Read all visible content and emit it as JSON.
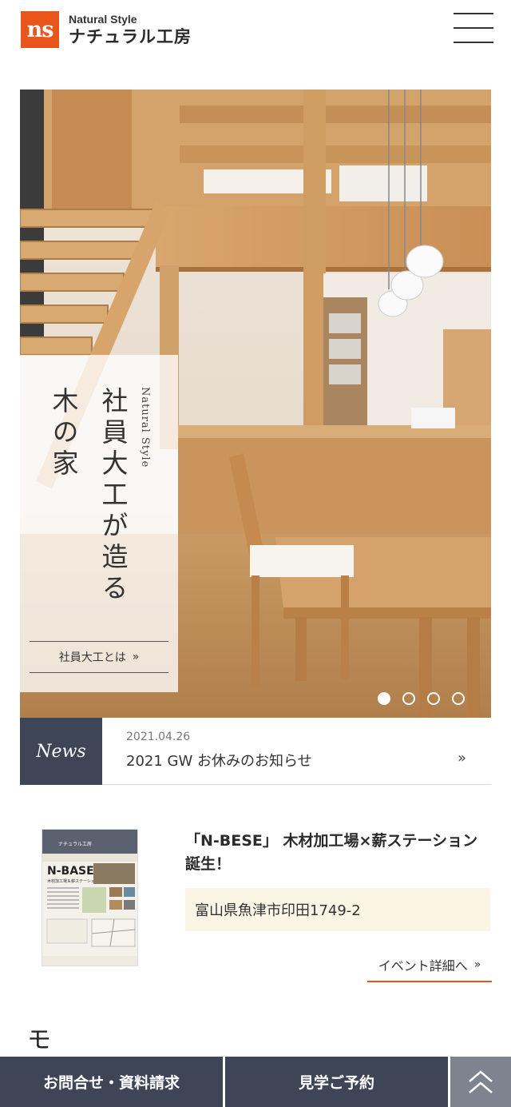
{
  "header": {
    "logo_mark": "ns",
    "logo_en": "Natural Style",
    "logo_jp": "ナチュラル工房"
  },
  "hero": {
    "en_label": "Natural Style",
    "catch_line1": "社員大工が造る",
    "catch_line2": "木の家",
    "button_label": "社員大工とは",
    "button_chevron": "»",
    "slide_count": 4,
    "active_slide": 1
  },
  "news": {
    "label": "News",
    "date": "2021.04.26",
    "title": "2021 GW お休みのお知らせ",
    "arrow": "»"
  },
  "event": {
    "title": "「N-BESE」 木材加工場×薪ステーション　誕生！",
    "address": "富山県魚津市印田1749-2",
    "link_label": "イベント詳細へ",
    "link_chevron": "»",
    "flyer_brand": "ナチュラル工房",
    "flyer_title": "N-BASE",
    "flyer_subtitle": "木材加工場＆薪ステーション"
  },
  "section": {
    "heading_partial": "モ"
  },
  "bottom_bar": {
    "contact_label": "お問合せ・資料請求",
    "visit_label": "見学ご予約",
    "top_icon": "double-chevron-up-icon"
  },
  "colors": {
    "accent": "#e8561c",
    "navy": "#3d4557",
    "gray": "#7d8490",
    "address_bg": "#fbf5e6"
  }
}
